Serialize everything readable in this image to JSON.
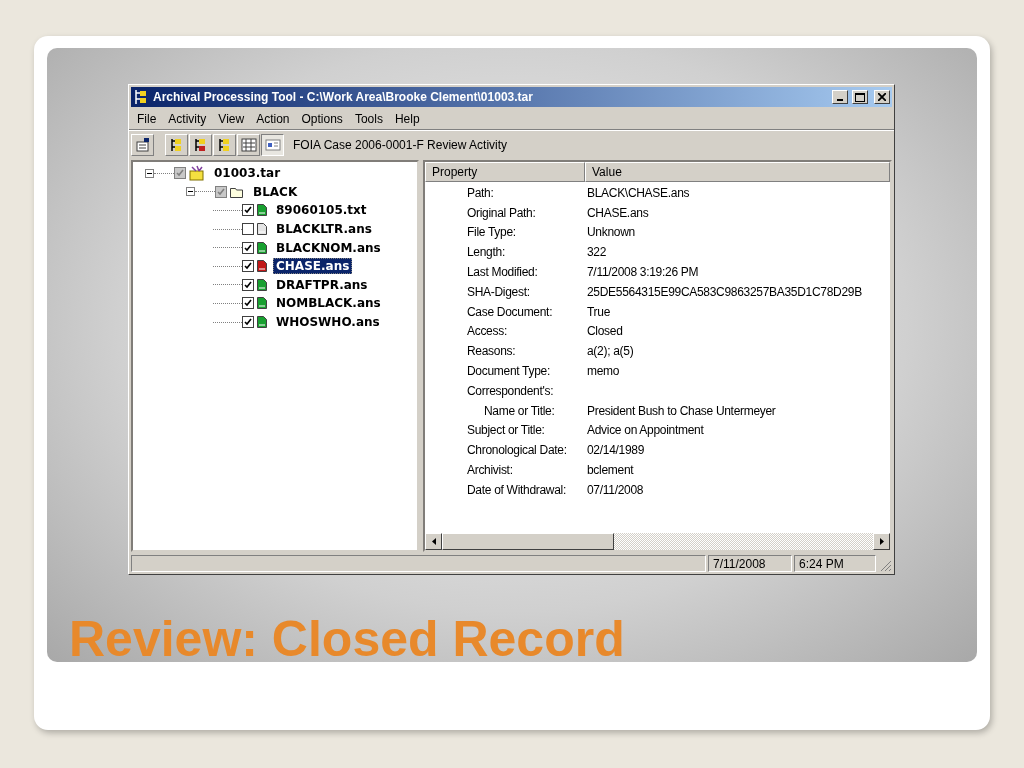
{
  "window": {
    "title": "Archival Processing Tool - C:\\Work Area\\Brooke Clement\\01003.tar"
  },
  "menu": [
    "File",
    "Activity",
    "View",
    "Action",
    "Options",
    "Tools",
    "Help"
  ],
  "toolbar": {
    "buttons": [
      {
        "selected": false
      },
      {
        "selected": false
      },
      {
        "selected": false
      },
      {
        "selected": false
      },
      {
        "selected": false
      },
      {
        "selected": true
      }
    ],
    "caption": "FOIA Case 2006-0001-F Review Activity"
  },
  "tree": [
    {
      "label": "01003.tar",
      "kind": "archive",
      "checked": true,
      "expanded": true,
      "selected": false,
      "children": [
        {
          "label": "BLACK",
          "kind": "folder",
          "checked": true,
          "expanded": true,
          "selected": false,
          "children": [
            {
              "label": "89060105.txt",
              "kind": "file",
              "checked": true,
              "selected": false,
              "color": "#18a030"
            },
            {
              "label": "BLACKLTR.ans",
              "kind": "file",
              "checked": false,
              "selected": false,
              "color": "#e4e4e4"
            },
            {
              "label": "BLACKNOM.ans",
              "kind": "file",
              "checked": true,
              "selected": false,
              "color": "#18a030"
            },
            {
              "label": "CHASE.ans",
              "kind": "file",
              "checked": true,
              "selected": true,
              "color": "#c01818"
            },
            {
              "label": "DRAFTPR.ans",
              "kind": "file",
              "checked": true,
              "selected": false,
              "color": "#18a030"
            },
            {
              "label": "NOMBLACK.ans",
              "kind": "file",
              "checked": true,
              "selected": false,
              "color": "#18a030"
            },
            {
              "label": "WHOSWHO.ans",
              "kind": "file",
              "checked": true,
              "selected": false,
              "color": "#18a030"
            }
          ]
        }
      ]
    }
  ],
  "properties": {
    "columns": [
      "Property",
      "Value"
    ],
    "rows": [
      {
        "property": "Path:",
        "value": "BLACK\\CHASE.ans"
      },
      {
        "property": "Original Path:",
        "value": "CHASE.ans"
      },
      {
        "property": "File Type:",
        "value": "Unknown"
      },
      {
        "property": "Length:",
        "value": "322"
      },
      {
        "property": "Last Modified:",
        "value": "7/11/2008 3:19:26 PM"
      },
      {
        "property": "SHA-Digest:",
        "value": "25DE5564315E99CA583C9863257BA35D1C78D29B"
      },
      {
        "property": "Case Document:",
        "value": "True"
      },
      {
        "property": "Access:",
        "value": "Closed"
      },
      {
        "property": "Reasons:",
        "value": "a(2); a(5)"
      },
      {
        "property": "Document Type:",
        "value": "memo"
      },
      {
        "property": "Correspondent's:",
        "children": [
          {
            "property": "Name or Title:",
            "value": "President Bush to Chase Untermeyer"
          }
        ]
      },
      {
        "property": "Subject or Title:",
        "value": "Advice on Appointment"
      },
      {
        "property": "Chronological Date:",
        "value": "02/14/1989"
      },
      {
        "property": "Archivist:",
        "value": "bclement"
      },
      {
        "property": "Date of Withdrawal:",
        "value": "07/11/2008"
      }
    ]
  },
  "status_bar": [
    "7/11/2008",
    "6:24 PM"
  ],
  "slide_title": "Review: Closed Record"
}
